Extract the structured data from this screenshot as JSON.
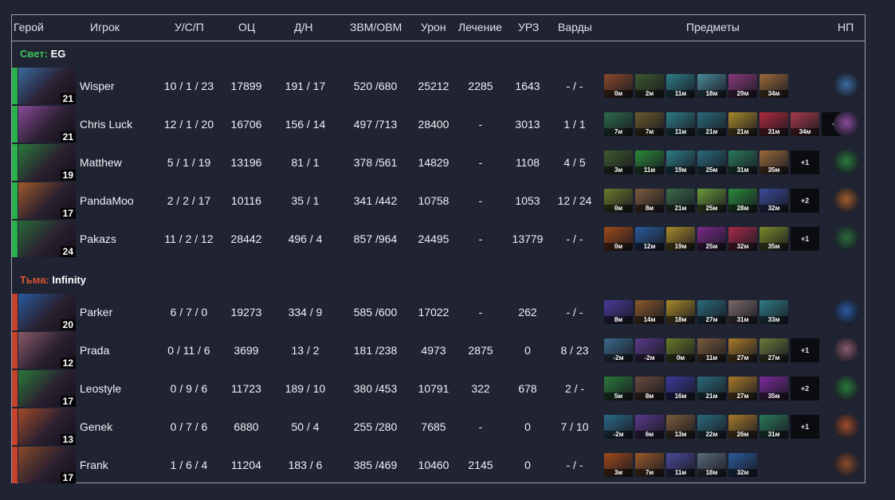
{
  "headers": {
    "hero": "Герой",
    "player": "Игрок",
    "kda": "У/С/П",
    "networth": "ОЦ",
    "lhdn": "Д/Н",
    "gpm_xpm": "ЗВМ/ОВМ",
    "damage": "Урон",
    "heal": "Лечение",
    "tower": "УРЗ",
    "wards": "Варды",
    "items": "Предметы",
    "np": "НП"
  },
  "teams": {
    "radiant": {
      "side": "Свет:",
      "name": "EG",
      "color": "#2bb14c"
    },
    "dire": {
      "side": "Тьма:",
      "name": "Infinity",
      "color": "#c8412b"
    }
  },
  "radiant_players": [
    {
      "player": "Wisper",
      "level": "21",
      "kda": "10 / 1 / 23",
      "networth": "17899",
      "lhdn": "191 / 17",
      "gpm_xpm": "520 /680",
      "damage": "25212",
      "heal": "2285",
      "tower": "1643",
      "wards": "- / -",
      "items": [
        {
          "t": "0м",
          "c": "#8a4a2a"
        },
        {
          "t": "2м",
          "c": "#3c5a2c"
        },
        {
          "t": "11м",
          "c": "#2e7c86"
        },
        {
          "t": "18м",
          "c": "#4a8a9a"
        },
        {
          "t": "29м",
          "c": "#8a3a7a"
        },
        {
          "t": "34м",
          "c": "#9a6a3a"
        }
      ],
      "more": "",
      "np_color": "#3a6aa0"
    },
    {
      "player": "Chris Luck",
      "level": "21",
      "kda": "12 / 1 / 20",
      "networth": "16706",
      "lhdn": "156 / 14",
      "gpm_xpm": "497 /713",
      "damage": "28400",
      "heal": "-",
      "tower": "3013",
      "wards": "1 / 1",
      "items": [
        {
          "t": "7м",
          "c": "#2c6a4a"
        },
        {
          "t": "7м",
          "c": "#6a5a2c"
        },
        {
          "t": "11м",
          "c": "#2e7c86"
        },
        {
          "t": "21м",
          "c": "#2a6a7a"
        },
        {
          "t": "21м",
          "c": "#a88a2a"
        },
        {
          "t": "31м",
          "c": "#b02a3a"
        },
        {
          "t": "34м",
          "c": "#a83a4a"
        }
      ],
      "more": "+1",
      "np_color": "#8a4a9a"
    },
    {
      "player": "Matthew",
      "level": "19",
      "kda": "5 / 1 / 19",
      "networth": "13196",
      "lhdn": "81 / 1",
      "gpm_xpm": "378 /561",
      "damage": "14829",
      "heal": "-",
      "tower": "1108",
      "wards": "4 / 5",
      "items": [
        {
          "t": "3м",
          "c": "#3c5a2c"
        },
        {
          "t": "11м",
          "c": "#2a8a3a"
        },
        {
          "t": "19м",
          "c": "#2e7c86"
        },
        {
          "t": "25м",
          "c": "#2a6a7a"
        },
        {
          "t": "31м",
          "c": "#2a7a5a"
        },
        {
          "t": "35м",
          "c": "#9a6a3a"
        }
      ],
      "more": "+1",
      "np_color": "#2a7a3a"
    },
    {
      "player": "PandaMoo",
      "level": "17",
      "kda": "2 / 2 / 17",
      "networth": "10116",
      "lhdn": "35 / 1",
      "gpm_xpm": "341 /442",
      "damage": "10758",
      "heal": "-",
      "tower": "1053",
      "wards": "12 / 24",
      "items": [
        {
          "t": "0м",
          "c": "#6a7a2a"
        },
        {
          "t": "8м",
          "c": "#7a5a3a"
        },
        {
          "t": "21м",
          "c": "#3a6a4a"
        },
        {
          "t": "25м",
          "c": "#6a9a3a"
        },
        {
          "t": "28м",
          "c": "#2a8a3a"
        },
        {
          "t": "32м",
          "c": "#3a4a9a"
        }
      ],
      "more": "+2",
      "np_color": "#a05a2a"
    },
    {
      "player": "Pakazs",
      "level": "24",
      "kda": "11 / 2 / 12",
      "networth": "28442",
      "lhdn": "496 / 4",
      "gpm_xpm": "857 /964",
      "damage": "24495",
      "heal": "-",
      "tower": "13779",
      "wards": "- / -",
      "items": [
        {
          "t": "0м",
          "c": "#a04a1a"
        },
        {
          "t": "12м",
          "c": "#2a5a9a"
        },
        {
          "t": "19м",
          "c": "#a88a2a"
        },
        {
          "t": "25м",
          "c": "#7a2a8a"
        },
        {
          "t": "32м",
          "c": "#a82a4a"
        },
        {
          "t": "35м",
          "c": "#7a8a2a"
        }
      ],
      "more": "+1",
      "np_color": "#2a6a3a"
    }
  ],
  "dire_players": [
    {
      "player": "Parker",
      "level": "20",
      "kda": "6 / 7 / 0",
      "networth": "19273",
      "lhdn": "334 / 9",
      "gpm_xpm": "585 /600",
      "damage": "17022",
      "heal": "-",
      "tower": "262",
      "wards": "- / -",
      "items": [
        {
          "t": "8м",
          "c": "#4a3a9a"
        },
        {
          "t": "14м",
          "c": "#8a5a2a"
        },
        {
          "t": "18м",
          "c": "#a88a2a"
        },
        {
          "t": "27м",
          "c": "#2a6a7a"
        },
        {
          "t": "31м",
          "c": "#7a6a6a"
        },
        {
          "t": "33м",
          "c": "#2e7c86"
        }
      ],
      "more": "",
      "np_color": "#2a5aa0"
    },
    {
      "player": "Prada",
      "level": "12",
      "kda": "0 / 11 / 6",
      "networth": "3699",
      "lhdn": "13 / 2",
      "gpm_xpm": "181 /238",
      "damage": "4973",
      "heal": "2875",
      "tower": "0",
      "wards": "8 / 23",
      "items": [
        {
          "t": "-2м",
          "c": "#3a6a8a"
        },
        {
          "t": "-2м",
          "c": "#5a3a8a"
        },
        {
          "t": "0м",
          "c": "#6a7a2a"
        },
        {
          "t": "11м",
          "c": "#7a5a3a"
        },
        {
          "t": "27м",
          "c": "#a87a2a"
        },
        {
          "t": "27м",
          "c": "#6a7a3a"
        }
      ],
      "more": "+1",
      "np_color": "#8a5a6a"
    },
    {
      "player": "Leostyle",
      "level": "17",
      "kda": "0 / 9 / 6",
      "networth": "11723",
      "lhdn": "189 / 10",
      "gpm_xpm": "380 /453",
      "damage": "10791",
      "heal": "322",
      "tower": "678",
      "wards": "2 / -",
      "items": [
        {
          "t": "5м",
          "c": "#2a7a3a"
        },
        {
          "t": "8м",
          "c": "#6a4a3a"
        },
        {
          "t": "16м",
          "c": "#3a3a9a"
        },
        {
          "t": "21м",
          "c": "#2a6a7a"
        },
        {
          "t": "27м",
          "c": "#a87a2a"
        },
        {
          "t": "35м",
          "c": "#7a2a9a"
        }
      ],
      "more": "+2",
      "np_color": "#2a7a3a"
    },
    {
      "player": "Genek",
      "level": "13",
      "kda": "0 / 7 / 6",
      "networth": "6880",
      "lhdn": "50 / 4",
      "gpm_xpm": "255 /280",
      "damage": "7685",
      "heal": "-",
      "tower": "0",
      "wards": "7 / 10",
      "items": [
        {
          "t": "-2м",
          "c": "#2a6a8a"
        },
        {
          "t": "6м",
          "c": "#5a3a8a"
        },
        {
          "t": "13м",
          "c": "#7a5a3a"
        },
        {
          "t": "22м",
          "c": "#2a6a7a"
        },
        {
          "t": "26м",
          "c": "#a87a2a"
        },
        {
          "t": "31м",
          "c": "#2a7a5a"
        }
      ],
      "more": "+1",
      "np_color": "#a04a2a"
    },
    {
      "player": "Frank",
      "level": "17",
      "kda": "1 / 6 / 4",
      "networth": "11204",
      "lhdn": "183 / 6",
      "gpm_xpm": "385 /469",
      "damage": "10460",
      "heal": "2145",
      "tower": "0",
      "wards": "- / -",
      "items": [
        {
          "t": "3м",
          "c": "#a04a1a"
        },
        {
          "t": "7м",
          "c": "#9a5a2a"
        },
        {
          "t": "11м",
          "c": "#4a4a9a"
        },
        {
          "t": "18м",
          "c": "#5a6a7a"
        },
        {
          "t": "32м",
          "c": "#2a5a9a"
        }
      ],
      "more": "",
      "np_color": "#8a4a2a"
    }
  ]
}
